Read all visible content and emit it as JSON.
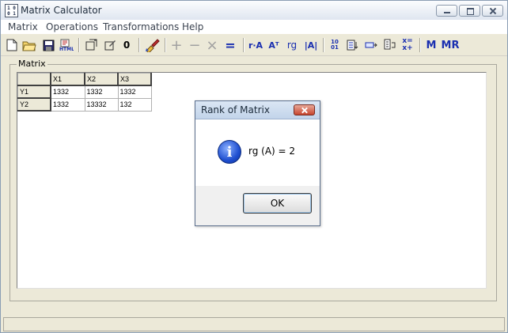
{
  "window": {
    "title": "Matrix Calculator",
    "icon_text": "1 0\n0 1"
  },
  "menu": [
    "Matrix",
    "Operations",
    "Transformations",
    "Help"
  ],
  "toolbar": {
    "zero_label": "0",
    "plus_label": "+",
    "minus_label": "−",
    "times_label": "×",
    "equals_label": "=",
    "ra_label": "r·A",
    "transpose_label": "Aᵀ",
    "rank_label": "rg",
    "det_label": "|A|",
    "m_label": "M",
    "mr_label": "MR",
    "identity_label": "10\n01",
    "enabled_color": "#1a2fb0",
    "disabled_color": "#a0a0a0"
  },
  "group": {
    "label": "Matrix"
  },
  "table": {
    "columns": [
      "",
      "X1",
      "X2",
      "X3"
    ],
    "rows": [
      {
        "label": "Y1",
        "cells": [
          "1332",
          "1332",
          "1332"
        ]
      },
      {
        "label": "Y2",
        "cells": [
          "1332",
          "13332",
          "132"
        ]
      }
    ]
  },
  "dialog": {
    "title": "Rank of Matrix",
    "icon": "info-icon",
    "message": "rg (A) = 2",
    "ok_label": "OK",
    "close_color": "#c7452e"
  }
}
